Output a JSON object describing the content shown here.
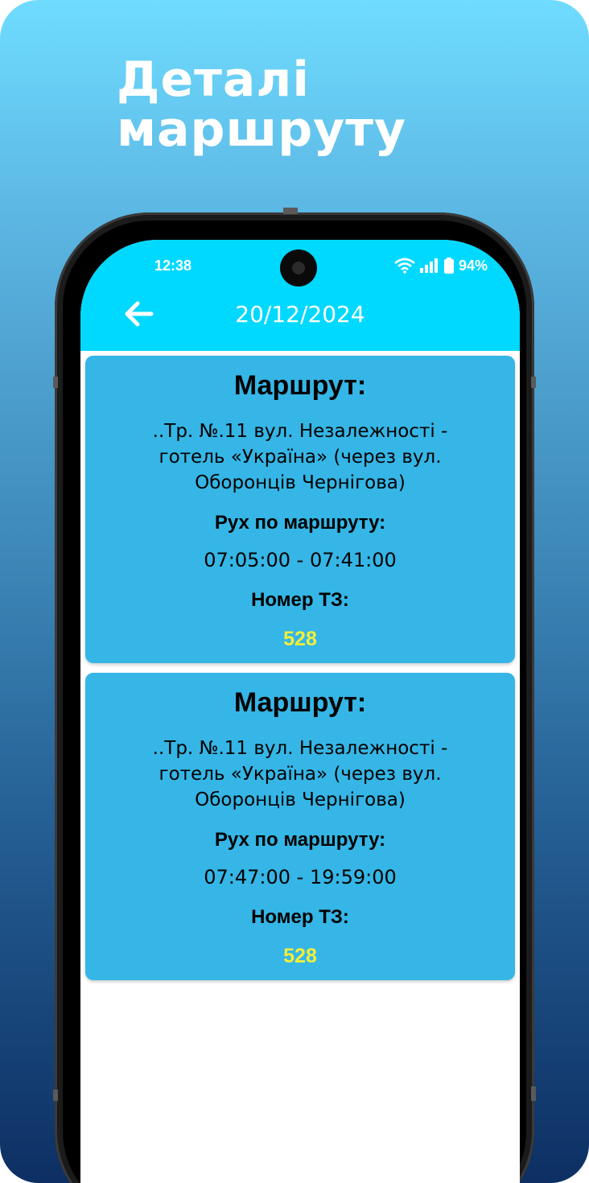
{
  "promo": {
    "headline_line1": "Деталі",
    "headline_line2": "маршруту"
  },
  "status_bar": {
    "time": "12:38",
    "battery": "94%",
    "icons": [
      "wifi-icon",
      "signal-icon",
      "battery-icon"
    ]
  },
  "app_bar": {
    "title": "20/12/2024",
    "back_icon": "arrow-left-icon"
  },
  "colors": {
    "app_bar": "#00d9ff",
    "card": "#35b6e6",
    "vehicle_number": "#f3ee3a"
  },
  "routes": [
    {
      "title": "Маршрут:",
      "route": "..Тр. №.11 вул. Незалежності - готель «Україна» (через вул. Оборонців Чернігова)",
      "schedule_label": "Рух по маршруту:",
      "schedule": "07:05:00 - 07:41:00",
      "vehicle_label": "Номер ТЗ:",
      "vehicle_number": "528"
    },
    {
      "title": "Маршрут:",
      "route": "..Тр. №.11 вул. Незалежності - готель «Україна» (через вул. Оборонців Чернігова)",
      "schedule_label": "Рух по маршруту:",
      "schedule": "07:47:00 - 19:59:00",
      "vehicle_label": "Номер ТЗ:",
      "vehicle_number": "528"
    }
  ]
}
